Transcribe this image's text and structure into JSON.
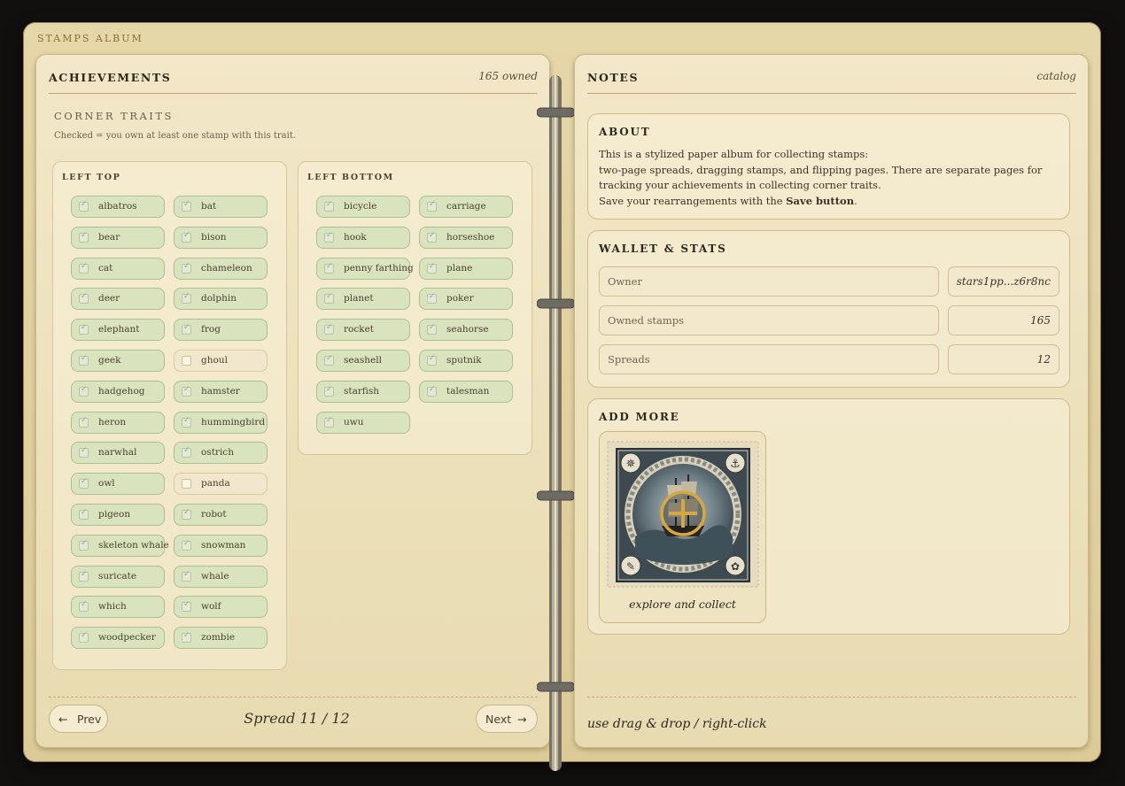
{
  "album": {
    "title": "STAMPS ALBUM"
  },
  "left_page": {
    "title": "ACHIEVEMENTS",
    "owned_label": "165 owned",
    "section_title": "CORNER TRAITS",
    "section_sub": "Checked = you own at least one stamp with this trait.",
    "groups": [
      {
        "title": "LEFT TOP",
        "traits": [
          {
            "label": "albatros",
            "checked": true
          },
          {
            "label": "bat",
            "checked": true
          },
          {
            "label": "bear",
            "checked": true
          },
          {
            "label": "bison",
            "checked": true
          },
          {
            "label": "cat",
            "checked": true
          },
          {
            "label": "chameleon",
            "checked": true
          },
          {
            "label": "deer",
            "checked": true
          },
          {
            "label": "dolphin",
            "checked": true
          },
          {
            "label": "elephant",
            "checked": true
          },
          {
            "label": "frog",
            "checked": true
          },
          {
            "label": "geek",
            "checked": true
          },
          {
            "label": "ghoul",
            "checked": false
          },
          {
            "label": "hadgehog",
            "checked": true
          },
          {
            "label": "hamster",
            "checked": true
          },
          {
            "label": "heron",
            "checked": true
          },
          {
            "label": "hummingbird",
            "checked": true
          },
          {
            "label": "narwhal",
            "checked": true
          },
          {
            "label": "ostrich",
            "checked": true
          },
          {
            "label": "owl",
            "checked": true
          },
          {
            "label": "panda",
            "checked": false
          },
          {
            "label": "pigeon",
            "checked": true
          },
          {
            "label": "robot",
            "checked": true
          },
          {
            "label": "skeleton whale",
            "checked": true
          },
          {
            "label": "snowman",
            "checked": true
          },
          {
            "label": "suricate",
            "checked": true
          },
          {
            "label": "whale",
            "checked": true
          },
          {
            "label": "which",
            "checked": true
          },
          {
            "label": "wolf",
            "checked": true
          },
          {
            "label": "woodpecker",
            "checked": true
          },
          {
            "label": "zombie",
            "checked": true
          }
        ]
      },
      {
        "title": "LEFT BOTTOM",
        "traits": [
          {
            "label": "bicycle",
            "checked": true
          },
          {
            "label": "carriage",
            "checked": true
          },
          {
            "label": "hook",
            "checked": true
          },
          {
            "label": "horseshoe",
            "checked": true
          },
          {
            "label": "penny farthing",
            "checked": true
          },
          {
            "label": "plane",
            "checked": true
          },
          {
            "label": "planet",
            "checked": true
          },
          {
            "label": "poker",
            "checked": true
          },
          {
            "label": "rocket",
            "checked": true
          },
          {
            "label": "seahorse",
            "checked": true
          },
          {
            "label": "seashell",
            "checked": true
          },
          {
            "label": "sputnik",
            "checked": true
          },
          {
            "label": "starfish",
            "checked": true
          },
          {
            "label": "talesman",
            "checked": true
          },
          {
            "label": "uwu",
            "checked": true
          }
        ]
      }
    ],
    "footer": {
      "prev_label": "Prev",
      "next_label": "Next",
      "spread_label": "Spread 11 / 12"
    }
  },
  "right_page": {
    "title": "NOTES",
    "meta": "catalog",
    "about": {
      "title": "ABOUT",
      "line1": "This is a stylized paper album for collecting stamps:",
      "line2": "two-page spreads, dragging stamps, and flipping pages. There are separate pages for tracking your achievements in collecting corner traits.",
      "line3_prefix": "Save your rearrangements with the ",
      "line3_bold": "Save button",
      "line3_suffix": "."
    },
    "wallet": {
      "title": "WALLET & STATS",
      "owner_label": "Owner",
      "owner_value": "stars1pp...z6r8nc",
      "owned_label": "Owned stamps",
      "owned_value": "165",
      "spreads_label": "Spreads",
      "spreads_value": "12"
    },
    "add_more": {
      "title": "ADD MORE",
      "caption": "explore and collect"
    },
    "hint": "use drag & drop / right-click"
  },
  "colors": {
    "page": "#f2e7c8",
    "chip_checked": "#d9e3bd",
    "chip_unchecked": "#f1e7cc",
    "accent_gold": "#d8a93a"
  }
}
